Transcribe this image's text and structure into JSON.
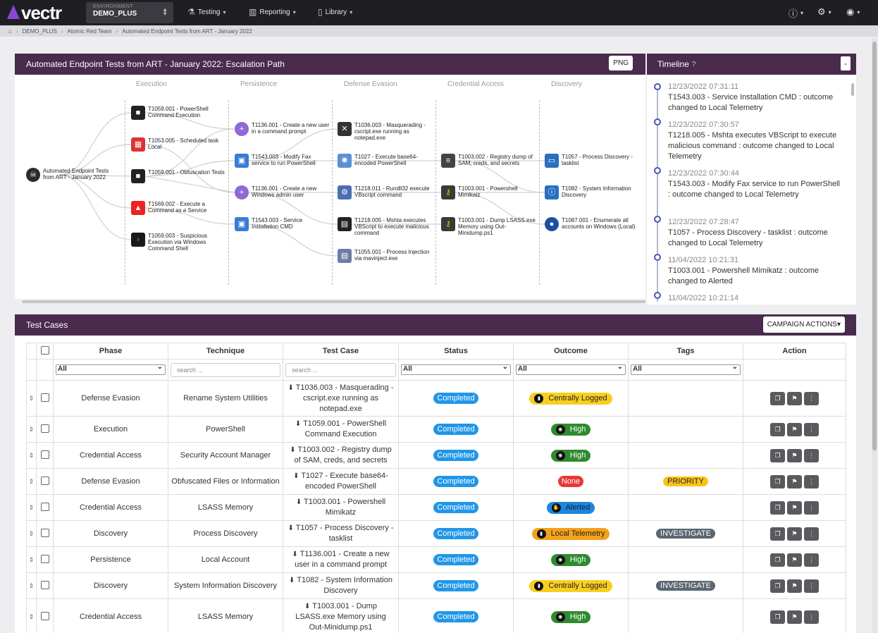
{
  "app": {
    "logo": "vectr"
  },
  "env": {
    "label": "ENVIRONMENT",
    "value": "DEMO_PLUS"
  },
  "nav": {
    "testing": "Testing",
    "reporting": "Reporting",
    "library": "Library"
  },
  "breadcrumbs": [
    "DEMO_PLUS",
    "Atomic Red Team",
    "Automated Endpoint Tests from ART - January 2022"
  ],
  "escalation": {
    "title": "Automated Endpoint Tests from ART - January 2022: Escalation Path",
    "png_label": "PNG",
    "columns": [
      "Execution",
      "Persistence",
      "Defense Evasion",
      "Credential Access",
      "Discovery"
    ],
    "root": "Automated Endpoint Tests from ART - January 2022",
    "nodes": {
      "n1": "T1059.001 - PowerShell Command Execution",
      "n2": "T1053.005 - Scheduled task Local",
      "n3": "T1059.001 - Obfuscation Tests",
      "n4": "T1569.002 - Execute a Command as a Service",
      "n5": "T1059.003 - Suspicious Execution via Windows Command Shell",
      "p1": "T1136.001 - Create a new user in a command prompt",
      "p2": "T1543.003 - Modify Fax service to run PowerShell",
      "p3": "T1136.001 - Create a new Windows admin user",
      "p4": "T1543.003 - Service Installation CMD",
      "d1": "T1036.003 - Masquerading - cscript.exe running as notepad.exe",
      "d2": "T1027 - Execute base64-encoded PowerShell",
      "d3": "T1218.011 - Rundll32 execute VBscript command",
      "d4": "T1218.005 - Mshta executes VBScript to execute malicious command",
      "d5": "T1055.001 - Process Injection via mavinject.exe",
      "c1": "T1003.002 - Registry dump of SAM, creds, and secrets",
      "c2": "T1003.001 - Powershell Mimikatz",
      "c3": "T1003.001 - Dump LSASS.exe Memory using Out-Minidump.ps1",
      "v1": "T1057 - Process Discovery - tasklist",
      "v2": "T1082 - System Information Discovery",
      "v3": "T1087.001 - Enumerate all accounts on Windows (Local)"
    }
  },
  "timeline": {
    "title": "Timeline",
    "collapse_label": "-",
    "items": [
      {
        "date": "12/23/2022 07:31:11",
        "text": "T1543.003 - Service Installation CMD : outcome changed to Local Telemetry"
      },
      {
        "date": "12/23/2022 07:30:57",
        "text": "T1218.005 - Mshta executes VBScript to execute malicious command : outcome changed to Local Telemetry"
      },
      {
        "date": "12/23/2022 07:30:44",
        "text": "T1543.003 - Modify Fax service to run PowerShell : outcome changed to Local Telemetry"
      },
      {
        "date": "12/23/2022 07:28:47",
        "text": "T1057 - Process Discovery - tasklist : outcome changed to Local Telemetry"
      },
      {
        "date": "11/04/2022 10:21:31",
        "text": "T1003.001 - Powershell Mimikatz : outcome changed to Alerted"
      },
      {
        "date": "11/04/2022 10:21:14",
        "text": ""
      }
    ]
  },
  "testcases": {
    "title": "Test Cases",
    "campaign_actions": "CAMPAIGN ACTIONS",
    "headers": {
      "phase": "Phase",
      "technique": "Technique",
      "testcase": "Test Case",
      "status": "Status",
      "outcome": "Outcome",
      "tags": "Tags",
      "action": "Action"
    },
    "filters": {
      "phase": "All",
      "technique_ph": "search ...",
      "testcase_ph": "search ...",
      "status": "All",
      "outcome": "All",
      "tags": "All"
    },
    "rows": [
      {
        "phase": "Defense Evasion",
        "technique": "Rename System Utilities",
        "testcase": "T1036.003 - Masquerading - cscript.exe running as notepad.exe",
        "status": "Completed",
        "outcome": "Centrally Logged",
        "outcome_color": "#f9cf1f",
        "tag": ""
      },
      {
        "phase": "Execution",
        "technique": "PowerShell",
        "testcase": "T1059.001 - PowerShell Command Execution",
        "status": "Completed",
        "outcome": "High",
        "outcome_color": "#2f8a30",
        "tag": ""
      },
      {
        "phase": "Credential Access",
        "technique": "Security Account Manager",
        "testcase": "T1003.002 - Registry dump of SAM, creds, and secrets",
        "status": "Completed",
        "outcome": "High",
        "outcome_color": "#2f8a30",
        "tag": ""
      },
      {
        "phase": "Defense Evasion",
        "technique": "Obfuscated Files or Information",
        "testcase": "T1027 - Execute base64-encoded PowerShell",
        "status": "Completed",
        "outcome": "None",
        "outcome_color": "#e53935",
        "tag": "PRIORITY"
      },
      {
        "phase": "Credential Access",
        "technique": "LSASS Memory",
        "testcase": "T1003.001 - Powershell Mimikatz",
        "status": "Completed",
        "outcome": "Alerted",
        "outcome_color": "#1a86e0",
        "tag": ""
      },
      {
        "phase": "Discovery",
        "technique": "Process Discovery",
        "testcase": "T1057 - Process Discovery - tasklist",
        "status": "Completed",
        "outcome": "Local Telemetry",
        "outcome_color": "#f4a11b",
        "tag": "INVESTIGATE"
      },
      {
        "phase": "Persistence",
        "technique": "Local Account",
        "testcase": "T1136.001 - Create a new user in a command prompt",
        "status": "Completed",
        "outcome": "High",
        "outcome_color": "#2f8a30",
        "tag": ""
      },
      {
        "phase": "Discovery",
        "technique": "System Information Discovery",
        "testcase": "T1082 - System Information Discovery",
        "status": "Completed",
        "outcome": "Centrally Logged",
        "outcome_color": "#f9cf1f",
        "tag": "INVESTIGATE"
      },
      {
        "phase": "Credential Access",
        "technique": "LSASS Memory",
        "testcase": "T1003.001 - Dump LSASS.exe Memory using Out-Minidump.ps1",
        "status": "Completed",
        "outcome": "High",
        "outcome_color": "#2f8a30",
        "tag": ""
      }
    ]
  }
}
